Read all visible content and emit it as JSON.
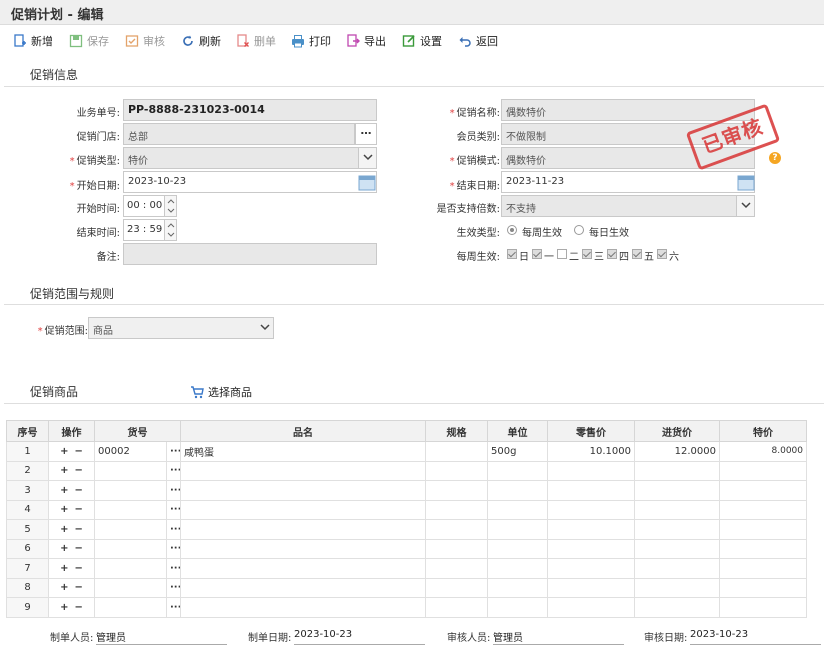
{
  "window": {
    "title": "促销计划 - 编辑"
  },
  "toolbar": {
    "add": "新增",
    "save": "保存",
    "audit": "审核",
    "refresh": "刷新",
    "delete": "删单",
    "print": "打印",
    "export": "导出",
    "settings": "设置",
    "back": "返回"
  },
  "section_info": {
    "title": "促销信息"
  },
  "form": {
    "doc_no_label": "业务单号:",
    "doc_no": "PP-8888-231023-0014",
    "store_label": "促销门店:",
    "store": "总部",
    "type_label": "促销类型:",
    "type": "特价",
    "start_date_label": "开始日期:",
    "start_date": "2023-10-23",
    "start_time_label": "开始时间:",
    "start_hh": "00",
    "start_mm": "00",
    "end_time_label": "结束时间:",
    "end_hh": "23",
    "end_mm": "59",
    "remark_label": "备注:",
    "remark": "",
    "name_label": "促销名称:",
    "name": "偶数特价",
    "member_label": "会员类别:",
    "member": "不做限制",
    "mode_label": "促销模式:",
    "mode": "偶数特价",
    "end_date_label": "结束日期:",
    "end_date": "2023-11-23",
    "multiple_label": "是否支持倍数:",
    "multiple": "不支持",
    "effect_type_label": "生效类型:",
    "effect_weekly": "每周生效",
    "effect_daily": "每日生效",
    "weekly_label": "每周生效:",
    "days": [
      "日",
      "一",
      "二",
      "三",
      "四",
      "五",
      "六"
    ]
  },
  "stamp": "已审核",
  "section_scope": {
    "title": "促销范围与规则"
  },
  "scope": {
    "label": "促销范围:",
    "value": "商品"
  },
  "section_goods": {
    "title": "促销商品",
    "select_btn": "选择商品"
  },
  "table": {
    "headers": [
      "序号",
      "操作",
      "货号",
      "品名",
      "规格",
      "单位",
      "零售价",
      "进货价",
      "特价"
    ],
    "rows": [
      {
        "idx": "1",
        "code": "00002",
        "name": "咸鸭蛋",
        "spec": "",
        "unit": "500g",
        "retail": "10.1000",
        "cost": "12.0000",
        "special": "8.0000"
      },
      {
        "idx": "2",
        "code": "",
        "name": "",
        "spec": "",
        "unit": "",
        "retail": "",
        "cost": "",
        "special": ""
      },
      {
        "idx": "3",
        "code": "",
        "name": "",
        "spec": "",
        "unit": "",
        "retail": "",
        "cost": "",
        "special": ""
      },
      {
        "idx": "4",
        "code": "",
        "name": "",
        "spec": "",
        "unit": "",
        "retail": "",
        "cost": "",
        "special": ""
      },
      {
        "idx": "5",
        "code": "",
        "name": "",
        "spec": "",
        "unit": "",
        "retail": "",
        "cost": "",
        "special": ""
      },
      {
        "idx": "6",
        "code": "",
        "name": "",
        "spec": "",
        "unit": "",
        "retail": "",
        "cost": "",
        "special": ""
      },
      {
        "idx": "7",
        "code": "",
        "name": "",
        "spec": "",
        "unit": "",
        "retail": "",
        "cost": "",
        "special": ""
      },
      {
        "idx": "8",
        "code": "",
        "name": "",
        "spec": "",
        "unit": "",
        "retail": "",
        "cost": "",
        "special": ""
      },
      {
        "idx": "9",
        "code": "",
        "name": "",
        "spec": "",
        "unit": "",
        "retail": "",
        "cost": "",
        "special": ""
      }
    ]
  },
  "footer": {
    "maker_label": "制单人员:",
    "maker": "管理员",
    "make_date_label": "制单日期:",
    "make_date": "2023-10-23",
    "auditor_label": "审核人员:",
    "auditor": "管理员",
    "audit_date_label": "审核日期:",
    "audit_date": "2023-10-23"
  },
  "colors": {
    "accent": "#2a7bd4",
    "stamp": "#d93a3a",
    "required": "#e04040"
  }
}
